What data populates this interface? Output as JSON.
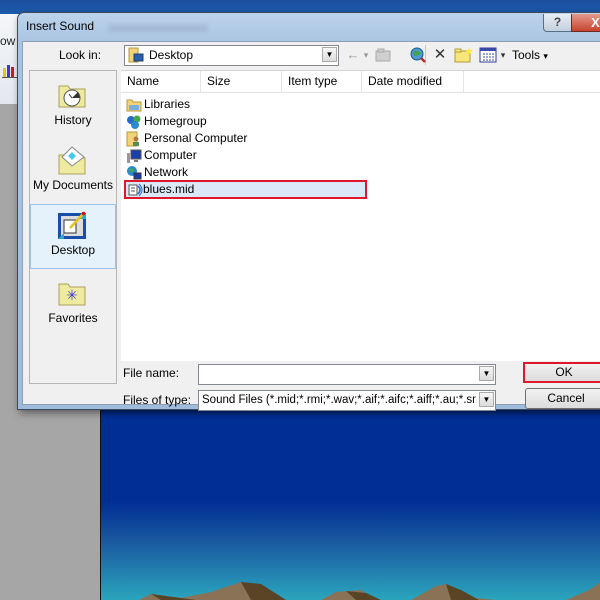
{
  "background_app": {
    "ribbon_text_fragment": "ow",
    "chart_icon": "bar-chart-icon"
  },
  "dialog": {
    "title": "Insert Sound",
    "help_button": "?",
    "close_button": "X",
    "look_in_label": "Look in:",
    "look_in_value": "Desktop",
    "toolbar": {
      "back_icon": "←",
      "back_dropdown": "▾",
      "up_folder_icon": "folder-up-icon",
      "search_web_icon": "search-web-icon",
      "delete_icon": "✕",
      "new_folder_icon": "new-folder-icon",
      "views_icon": "views-icon",
      "views_dropdown": "▾",
      "tools_label": "Tools",
      "tools_dropdown": "▾"
    },
    "places": [
      {
        "label": "History",
        "icon": "history-folder-icon",
        "selected": false
      },
      {
        "label": "My Documents",
        "icon": "my-documents-icon",
        "selected": false
      },
      {
        "label": "Desktop",
        "icon": "desktop-icon",
        "selected": true
      },
      {
        "label": "Favorites",
        "icon": "favorites-folder-icon",
        "selected": false
      }
    ],
    "columns": [
      "Name",
      "Size",
      "Item type",
      "Date modified"
    ],
    "files": [
      {
        "name": "Libraries",
        "icon": "libraries-icon"
      },
      {
        "name": "Homegroup",
        "icon": "homegroup-icon"
      },
      {
        "name": "Personal Computer",
        "icon": "user-folder-icon"
      },
      {
        "name": "Computer",
        "icon": "computer-icon"
      },
      {
        "name": "Network",
        "icon": "network-icon"
      },
      {
        "name": "blues.mid",
        "icon": "midi-file-icon",
        "selected": true
      }
    ],
    "file_name_label": "File name:",
    "file_name_value": "",
    "files_of_type_label": "Files of type:",
    "files_of_type_value": "Sound Files (*.mid;*.rmi;*.wav;*.aif;*.aifc;*.aiff;*.au;*.snd)",
    "ok_label": "OK",
    "cancel_label": "Cancel",
    "highlight_color": "#e0162b"
  }
}
